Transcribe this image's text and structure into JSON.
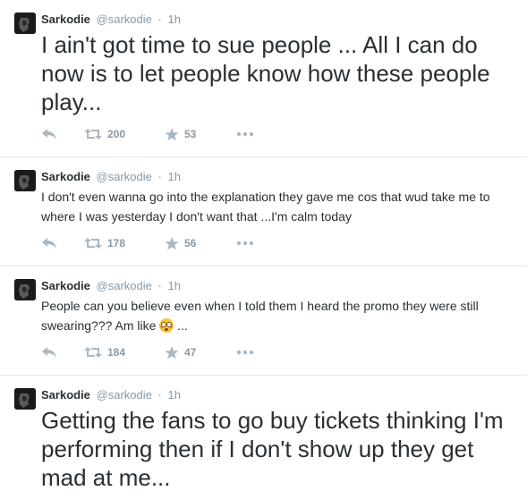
{
  "tweets": [
    {
      "name": "Sarkodie",
      "handle": "@sarkodie",
      "separator": "·",
      "time": "1h",
      "text": "I ain't got time to sue people ... All I can do now is to let people know how these people play...",
      "retweets": "200",
      "favorites": "53"
    },
    {
      "name": "Sarkodie",
      "handle": "@sarkodie",
      "separator": "·",
      "time": "1h",
      "text": "I don't even wanna go into the explanation they gave me cos that wud take me to where I was yesterday I don't want that ...I'm calm today",
      "retweets": "178",
      "favorites": "56"
    },
    {
      "name": "Sarkodie",
      "handle": "@sarkodie",
      "separator": "·",
      "time": "1h",
      "text_before_emoji": "People can you believe even when I told them I heard the promo they were still swearing??? Am like ",
      "emoji": "flushed-face",
      "text_after_emoji": " ...",
      "retweets": "184",
      "favorites": "47"
    },
    {
      "name": "Sarkodie",
      "handle": "@sarkodie",
      "separator": "·",
      "time": "1h",
      "text": "Getting the fans to go buy tickets thinking I'm performing then if I don't show up they get mad at me..."
    }
  ],
  "colors": {
    "text": "#292f33",
    "muted": "#8899a6",
    "icon": "#aab8c2",
    "divider": "#e1e8ed"
  },
  "icons": [
    "avatar",
    "reply-icon",
    "retweet-icon",
    "favorite-star-icon",
    "more-options-icon"
  ]
}
